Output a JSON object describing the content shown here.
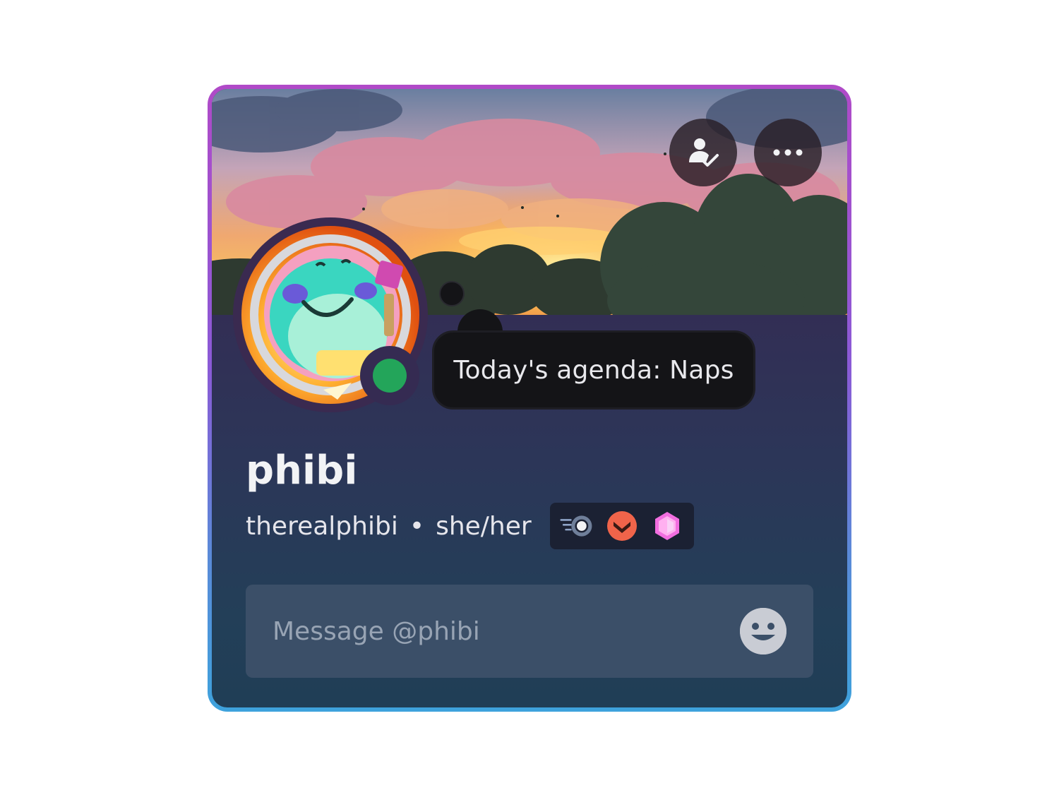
{
  "profile": {
    "display_name": "phibi",
    "username": "therealphibi",
    "separator": "•",
    "pronouns": "she/her",
    "status": "online",
    "custom_status": "Today's agenda: Naps"
  },
  "actions": {
    "friend_icon": "friend-check-icon",
    "more_icon": "more-options-icon"
  },
  "badges": [
    {
      "icon": "nitro-badge-icon"
    },
    {
      "icon": "hypesquad-badge-icon"
    },
    {
      "icon": "server-boost-badge-icon"
    }
  ],
  "message": {
    "placeholder": "Message @phibi",
    "emoji_icon": "emoji-icon"
  },
  "colors": {
    "gradient_top": "#b04ac8",
    "gradient_bottom": "#3ea2dc",
    "online": "#23a55a"
  }
}
